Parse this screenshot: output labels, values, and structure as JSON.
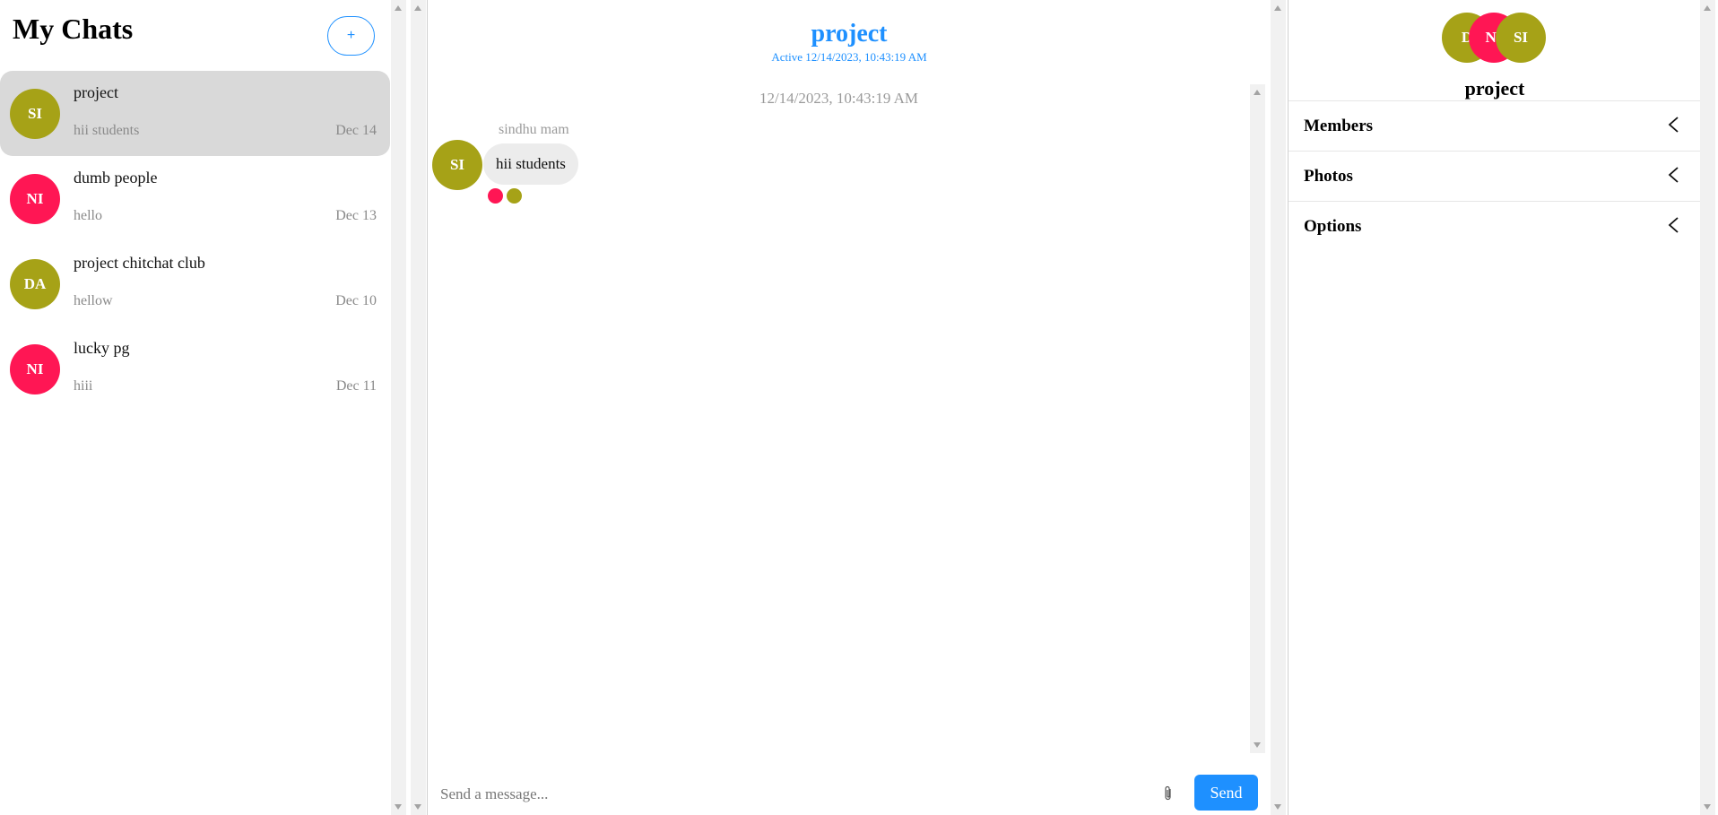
{
  "sidebar": {
    "title": "My Chats",
    "new_button": "+",
    "chats": [
      {
        "initials": "SI",
        "name": "project",
        "preview": "hii students",
        "date": "Dec 14",
        "color": "#a6a217",
        "active": true
      },
      {
        "initials": "NI",
        "name": "dumb people",
        "preview": "hello",
        "date": "Dec 13",
        "color": "#ff1654"
      },
      {
        "initials": "DA",
        "name": "project chitchat club",
        "preview": "hellow",
        "date": "Dec 10",
        "color": "#a6a217"
      },
      {
        "initials": "NI",
        "name": "lucky pg",
        "preview": "hiii",
        "date": "Dec 11",
        "color": "#ff1654"
      }
    ]
  },
  "conversation": {
    "title": "project",
    "status": "Active 12/14/2023, 10:43:19 AM",
    "date_divider": "12/14/2023, 10:43:19 AM",
    "messages": [
      {
        "sender": "sindhu mam",
        "initials": "SI",
        "text": "hii students",
        "avatar_color": "#a6a217",
        "read_by_colors": [
          "#ff1654",
          "#a6a217"
        ]
      }
    ],
    "composer": {
      "placeholder": "Send a message...",
      "attach_icon": "paperclip-icon",
      "send_label": "Send"
    }
  },
  "details": {
    "avatars": [
      {
        "initials": "D",
        "color": "#a6a217"
      },
      {
        "initials": "NI",
        "color": "#ff1654"
      },
      {
        "initials": "SI",
        "color": "#a6a217"
      }
    ],
    "group_name": "project",
    "sections": [
      {
        "label": "Members",
        "icon": "chevron-left-icon"
      },
      {
        "label": "Photos",
        "icon": "chevron-left-icon"
      },
      {
        "label": "Options",
        "icon": "chevron-left-icon"
      }
    ]
  },
  "colors": {
    "accent": "#1e90ff",
    "olive": "#a6a217",
    "pink": "#ff1654",
    "active_bg": "#d9d9d9"
  }
}
